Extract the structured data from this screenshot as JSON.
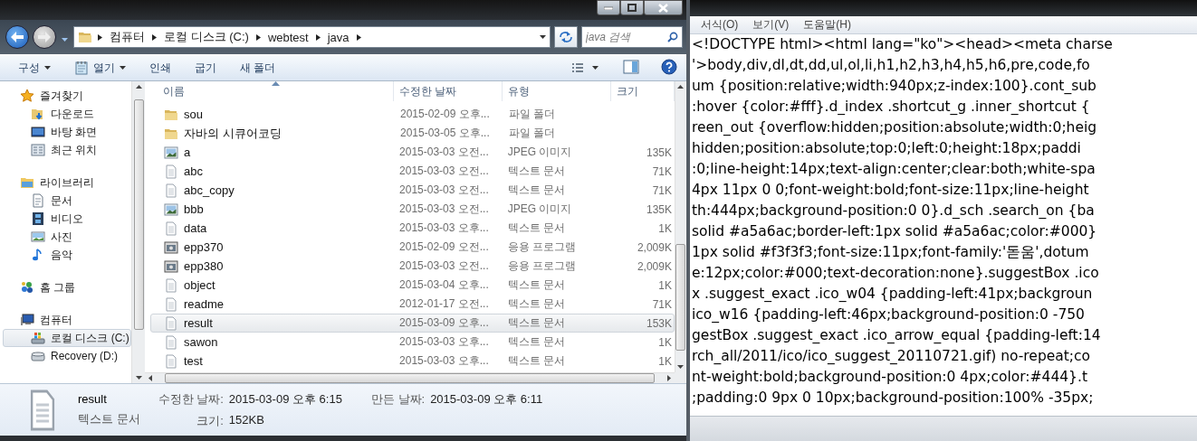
{
  "explorer": {
    "breadcrumb": [
      "컴퓨터",
      "로컬 디스크 (C:)",
      "webtest",
      "java"
    ],
    "search": {
      "placeholder": "java 검색"
    },
    "toolbar": [
      {
        "label": "구성",
        "kind": "menu",
        "dropdown": true
      },
      {
        "label": "열기",
        "kind": "app",
        "dropdown": true
      },
      {
        "label": "인쇄",
        "kind": "plain",
        "dropdown": false
      },
      {
        "label": "굽기",
        "kind": "plain",
        "dropdown": false
      },
      {
        "label": "새 폴더",
        "kind": "plain",
        "dropdown": false
      }
    ],
    "sidebar": [
      {
        "label": "즐겨찾기",
        "kind": "star",
        "children": [
          {
            "label": "다운로드",
            "kind": "download",
            "selected": false
          },
          {
            "label": "바탕 화면",
            "kind": "desktop",
            "selected": false
          },
          {
            "label": "최근 위치",
            "kind": "recent",
            "selected": false
          }
        ]
      },
      {
        "label": "라이브러리",
        "kind": "library",
        "children": [
          {
            "label": "문서",
            "kind": "document",
            "selected": false
          },
          {
            "label": "비디오",
            "kind": "video",
            "selected": false
          },
          {
            "label": "사진",
            "kind": "photo",
            "selected": false
          },
          {
            "label": "음악",
            "kind": "music",
            "selected": false
          }
        ]
      },
      {
        "label": "홈 그룹",
        "kind": "homegroup"
      },
      {
        "label": "컴퓨터",
        "kind": "computer",
        "children": [
          {
            "label": "로컬 디스크 (C:)",
            "kind": "drive-system",
            "selected": true
          },
          {
            "label": "Recovery (D:)",
            "kind": "drive",
            "selected": false
          }
        ]
      }
    ],
    "columns": [
      {
        "label": "이름",
        "sorted": true
      },
      {
        "label": "수정한 날짜",
        "sorted": false
      },
      {
        "label": "유형",
        "sorted": false
      },
      {
        "label": "크기",
        "sorted": false
      }
    ],
    "files": [
      {
        "name": "sou",
        "date": "2015-02-09 오후...",
        "type": "파일 폴더",
        "kind": "folder",
        "selected": false
      },
      {
        "name": "자바의 시큐어코딩",
        "date": "2015-03-05 오후...",
        "type": "파일 폴더",
        "kind": "folder",
        "selected": false
      },
      {
        "name": "a",
        "date": "2015-03-03 오전...",
        "type": "JPEG 이미지",
        "size": "135K",
        "kind": "image",
        "selected": false
      },
      {
        "name": "abc",
        "date": "2015-03-03 오전...",
        "type": "텍스트 문서",
        "size": "71K",
        "kind": "text",
        "selected": false
      },
      {
        "name": "abc_copy",
        "date": "2015-03-03 오전...",
        "type": "텍스트 문서",
        "size": "71K",
        "kind": "text",
        "selected": false
      },
      {
        "name": "bbb",
        "date": "2015-03-03 오전...",
        "type": "JPEG 이미지",
        "size": "135K",
        "kind": "image",
        "selected": false
      },
      {
        "name": "data",
        "date": "2015-03-03 오후...",
        "type": "텍스트 문서",
        "size": "1K",
        "kind": "text",
        "selected": false
      },
      {
        "name": "epp370",
        "date": "2015-02-09 오전...",
        "type": "응용 프로그램",
        "size": "2,009K",
        "kind": "app",
        "selected": false
      },
      {
        "name": "epp380",
        "date": "2015-03-03 오전...",
        "type": "응용 프로그램",
        "size": "2,009K",
        "kind": "app",
        "selected": false
      },
      {
        "name": "object",
        "date": "2015-03-04 오후...",
        "type": "텍스트 문서",
        "size": "1K",
        "kind": "text",
        "selected": false
      },
      {
        "name": "readme",
        "date": "2012-01-17 오전...",
        "type": "텍스트 문서",
        "size": "71K",
        "kind": "text",
        "selected": false
      },
      {
        "name": "result",
        "date": "2015-03-09 오후...",
        "type": "텍스트 문서",
        "size": "153K",
        "kind": "text",
        "selected": true
      },
      {
        "name": "sawon",
        "date": "2015-03-03 오후...",
        "type": "텍스트 문서",
        "size": "1K",
        "kind": "text",
        "selected": false
      },
      {
        "name": "test",
        "date": "2015-03-03 오후...",
        "type": "텍스트 문서",
        "size": "1K",
        "kind": "text",
        "selected": false
      }
    ],
    "details": {
      "name": "result",
      "type": "텍스트 문서",
      "kind": "text",
      "fields": [
        {
          "label": "수정한 날짜:",
          "value": "2015-03-09 오후 6:15"
        },
        {
          "label": "만든 날짜:",
          "value": "2015-03-09 오후 6:11"
        },
        {
          "label": "크기:",
          "value": "152KB"
        }
      ]
    }
  },
  "notepad": {
    "menu": [
      "서식(O)",
      "보기(V)",
      "도움말(H)"
    ],
    "lines": [
      "<!DOCTYPE html><html lang=\"ko\"><head><meta charse",
      "'>body,div,dl,dt,dd,ul,ol,li,h1,h2,h3,h4,h5,h6,pre,code,fo",
      "um {position:relative;width:940px;z-index:100}.cont_sub",
      ":hover {color:#fff}.d_index .shortcut_g .inner_shortcut {",
      "reen_out {overflow:hidden;position:absolute;width:0;heig",
      "hidden;position:absolute;top:0;left:0;height:18px;paddi",
      ":0;line-height:14px;text-align:center;clear:both;white-spa",
      "4px 11px 0 0;font-weight:bold;font-size:11px;line-height",
      "th:444px;background-position:0 0}.d_sch .search_on {ba",
      "solid #a5a6ac;border-left:1px solid #a5a6ac;color:#000}",
      "1px solid #f3f3f3;font-size:11px;font-family:'돋움',dotum",
      "e:12px;color:#000;text-decoration:none}.suggestBox .ico",
      "x .suggest_exact .ico_w04 {padding-left:41px;backgroun",
      "ico_w16 {padding-left:46px;background-position:0 -750",
      "gestBox .suggest_exact .ico_arrow_equal {padding-left:14",
      "rch_all/2011/ico/ico_suggest_20110721.gif) no-repeat;co",
      "nt-weight:bold;background-position:0 4px;color:#444}.t",
      ";padding:0 9px 0 10px;background-position:100% -35px;"
    ]
  }
}
